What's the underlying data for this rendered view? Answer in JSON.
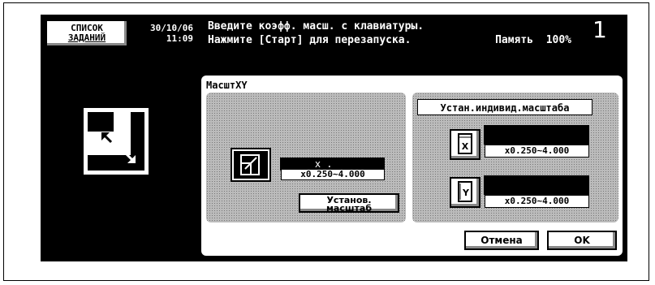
{
  "header": {
    "job_list_line1": "СПИСОК",
    "job_list_line2": "ЗАДАНИЙ",
    "date": "30/10/06",
    "time": "11:09",
    "message_line1": "Введите коэфф. масш. с клавиатуры.",
    "message_line2": "Нажмите [Старт] для перезапуска.",
    "memory": "Память  100%",
    "copies": "1"
  },
  "panel": {
    "title": "МасштXY",
    "xy_value": "x_.___",
    "xy_range": "x0.250~4.000",
    "set_scale_line1": "Установ.",
    "set_scale_line2": "масштаб",
    "individual_title": "Устан.индивид.масштаба",
    "x_icon_label": "X",
    "x_value": "",
    "x_range": "x0.250~4.000",
    "y_icon_label": "Y",
    "y_value": "",
    "y_range": "x0.250~4.000",
    "cancel_label": "Отмена",
    "ok_label": "OK"
  }
}
